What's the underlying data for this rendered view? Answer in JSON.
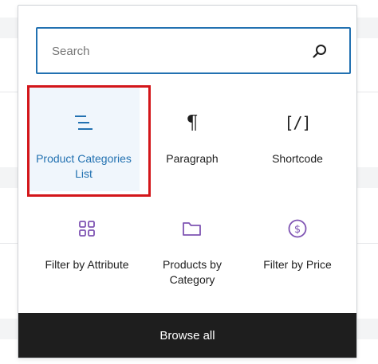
{
  "search": {
    "placeholder": "Search",
    "value": ""
  },
  "blocks": [
    {
      "label": "Product Categories List",
      "icon": "list-indent-icon",
      "active": true
    },
    {
      "label": "Paragraph",
      "icon": "paragraph-icon",
      "glyph": "¶"
    },
    {
      "label": "Shortcode",
      "icon": "shortcode-icon",
      "glyph": "[/]"
    },
    {
      "label": "Filter by Attribute",
      "icon": "grid-icon"
    },
    {
      "label": "Products by Category",
      "icon": "folder-icon"
    },
    {
      "label": "Filter by Price",
      "icon": "dollar-circle-icon"
    }
  ],
  "footer": {
    "browse_all_label": "Browse all"
  },
  "colors": {
    "accent": "#2271b1",
    "woo_purple": "#7f54b3",
    "highlight_border": "#d3161a",
    "footer_bg": "#1e1e1e"
  }
}
